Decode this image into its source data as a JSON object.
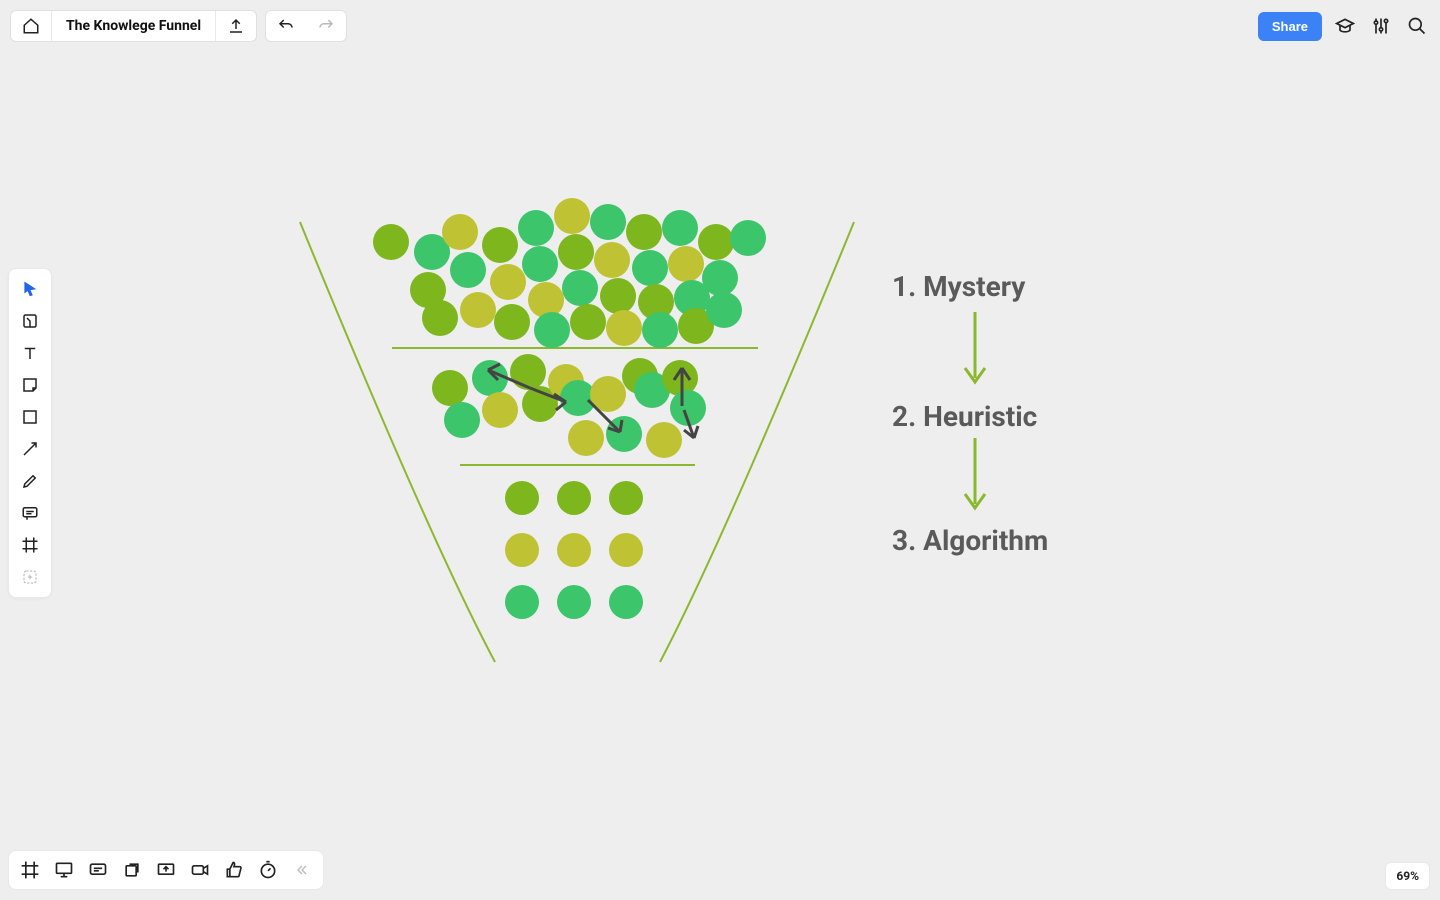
{
  "header": {
    "title": "The Knowlege Funnel",
    "share_label": "Share"
  },
  "labels": {
    "step1": "1. Mystery",
    "step2": "2. Heuristic",
    "step3": "3. Algorithm"
  },
  "zoom": "69%",
  "colors": {
    "funnel_line": "#8bb82f",
    "dot_bright": "#3cc56a",
    "dot_olive": "#bfc233",
    "dot_mid": "#7eb61e",
    "arrow": "#444"
  },
  "chart_data": {
    "type": "diagram",
    "title": "The Knowledge Funnel",
    "stages": [
      {
        "name": "Mystery",
        "order": 1,
        "visual": "many scattered dots, ~40"
      },
      {
        "name": "Heuristic",
        "order": 2,
        "visual": "fewer dots with connecting arrows, ~16"
      },
      {
        "name": "Algorithm",
        "order": 3,
        "visual": "9 dots in 3x3 grid"
      }
    ]
  }
}
